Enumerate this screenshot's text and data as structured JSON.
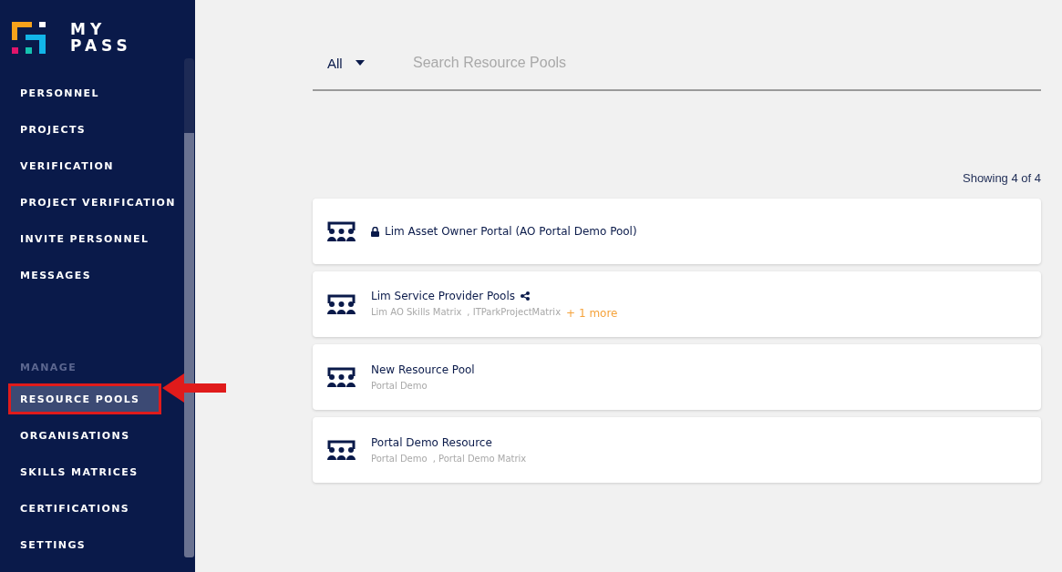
{
  "logo": {
    "line_1": "MY",
    "line_2": "PASS"
  },
  "sidebar": {
    "items": [
      {
        "label": "PERSONNEL",
        "selected": false
      },
      {
        "label": "PROJECTS",
        "selected": false
      },
      {
        "label": "VERIFICATION",
        "selected": false
      },
      {
        "label": "PROJECT VERIFICATION",
        "selected": false
      },
      {
        "label": "INVITE PERSONNEL",
        "selected": false
      },
      {
        "label": "MESSAGES",
        "selected": false
      }
    ],
    "section": "MANAGE",
    "manage_items": [
      {
        "label": "RESOURCE POOLS",
        "selected": true,
        "highlighted": true
      },
      {
        "label": "ORGANISATIONS",
        "selected": false,
        "highlighted": false
      },
      {
        "label": "SKILLS MATRICES",
        "selected": false,
        "highlighted": false
      },
      {
        "label": "CERTIFICATIONS",
        "selected": false,
        "highlighted": false
      },
      {
        "label": "SETTINGS",
        "selected": false,
        "highlighted": false
      }
    ]
  },
  "filter": {
    "value": "All"
  },
  "search": {
    "placeholder": "Search Resource Pools"
  },
  "count": "Showing 4 of 4",
  "pools": [
    {
      "name": "Lim Asset Owner Portal (AO Portal Demo Pool)",
      "locked": true,
      "shared": false
    },
    {
      "name": "Lim Service Provider Pools",
      "locked": false,
      "shared": true,
      "matrices": [
        "Lim AO Skills Matrix",
        ", ITParkProjectMatrix"
      ],
      "more": "+ 1 more"
    },
    {
      "name": "New Resource Pool",
      "locked": false,
      "shared": false,
      "matrices": [
        "Portal Demo"
      ]
    },
    {
      "name": "Portal Demo Resource",
      "locked": false,
      "shared": false,
      "matrices": [
        "Portal Demo",
        ", Portal Demo Matrix"
      ]
    }
  ]
}
